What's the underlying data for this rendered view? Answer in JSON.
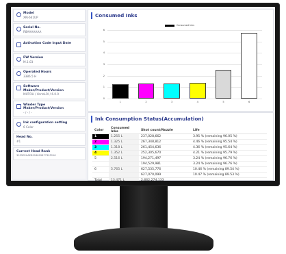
{
  "sidebar": {
    "items": [
      {
        "label": "Model",
        "value": "XPJ-661UP",
        "icon": "printer-icon"
      },
      {
        "label": "Serial No.",
        "value": "R8AAAAAAA",
        "icon": "barcode-icon"
      },
      {
        "label": "Activation Code Input Date",
        "value": "",
        "icon": "calendar-icon"
      },
      {
        "label": "FW Version",
        "value": "M.1.03",
        "icon": "chip-icon"
      },
      {
        "label": "Operated Hours",
        "value": "3386.5 H",
        "icon": "clock-icon"
      },
      {
        "label": "Software",
        "value2": "Maker/Product/Version",
        "value": "MUTOH / VerteLRI / 6.0.0",
        "icon": "software-icon"
      },
      {
        "label": "Winder Type",
        "value2": "Maker/Product/Version",
        "value": "- / - / -",
        "icon": "winder-icon"
      },
      {
        "label": "Ink configuration setting",
        "value": "6 Color",
        "icon": "ink-drop-icon"
      }
    ],
    "head_no": {
      "label": "Head No.",
      "value": "#1"
    },
    "current_head_rank": {
      "label": "Current Head Rank",
      "value": "3935EEAAEB91860987730F016"
    }
  },
  "consumed_inks": {
    "title": "Consumed Inks",
    "legend": "Consumed Inks",
    "colors": {
      "black": "#000000",
      "magenta": "#ff00ff",
      "cyan": "#00ffff",
      "yellow": "#ffff00",
      "gray": "#d9d9d9",
      "white": "#ffffff",
      "accent": "#3454c4"
    }
  },
  "chart_data": {
    "type": "bar",
    "title": "Consumed Inks",
    "categories": [
      "1",
      "2",
      "3",
      "4",
      "5",
      "6"
    ],
    "series": [
      {
        "name": "Consumed Inks",
        "values": [
          1.255,
          1.325,
          1.318,
          1.352,
          2.516,
          5.765
        ]
      }
    ],
    "y_ticks": [
      "0",
      "1",
      "2",
      "3",
      "4",
      "5",
      "6"
    ],
    "ylim": [
      0,
      6
    ],
    "bar_colors": [
      "#000000",
      "#ff00ff",
      "#00ffff",
      "#ffff00",
      "#d9d9d9",
      "#ffffff"
    ],
    "legend_position": "top-center",
    "grid": true
  },
  "ink_status": {
    "title": "Ink Consumption Status(Accumulation)",
    "headers": [
      "Color",
      "Consumed Inks",
      "Shot count/Nozzle",
      "Life"
    ],
    "rows": [
      {
        "color": "1",
        "ink": "1.255 L",
        "shot": "237,028,662",
        "life": "3.95 % (remaining 96.05 %)"
      },
      {
        "color": "2",
        "ink": "1.325 L",
        "shot": "267,348,812",
        "life": "4.46 % (remaining 95.54 %)"
      },
      {
        "color": "3",
        "ink": "1.318 L",
        "shot": "261,454,636",
        "life": "4.36 % (remaining 95.64 %)"
      },
      {
        "color": "4",
        "ink": "1.352 L",
        "shot": "252,305,670",
        "life": "4.21 % (remaining 95.79 %)"
      },
      {
        "color": "5",
        "ink": "2.516 L",
        "shot": "194,271,497",
        "life": "3.24 % (remaining 96.76 %)"
      },
      {
        "color": "",
        "ink": "",
        "shot": "194,529,981",
        "life": "3.24 % (remaining 96.76 %)"
      },
      {
        "color": "6",
        "ink": "5.765 L",
        "shot": "627,535,776",
        "life": "10.46 % (remaining 89.54 %)"
      },
      {
        "color": "",
        "ink": "",
        "shot": "627,070,099",
        "life": "10.47 % (remaining 89.53 %)"
      }
    ],
    "total": {
      "label": "Total",
      "ink": "13.471 L",
      "shot": "2,662,274,133"
    }
  }
}
